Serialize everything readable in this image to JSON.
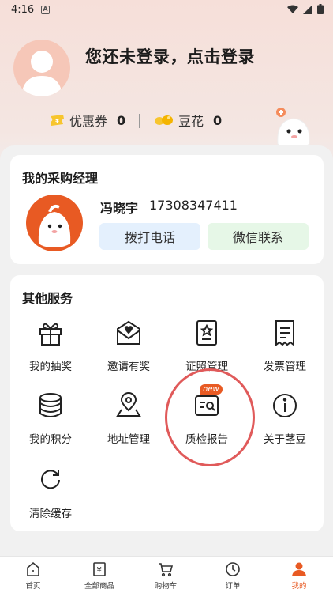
{
  "status_bar": {
    "time": "4:16",
    "notification_icon": "A"
  },
  "header": {
    "login_prompt": "您还未登录，点击登录",
    "coupon_label": "优惠券",
    "coupon_count": "0",
    "douhua_label": "豆花",
    "douhua_count": "0"
  },
  "manager": {
    "title": "我的采购经理",
    "name": "冯晓宇",
    "phone": "17308347411",
    "call_label": "拨打电话",
    "wechat_label": "微信联系"
  },
  "services": {
    "title": "其他服务",
    "new_badge": "new",
    "items": [
      {
        "label": "我的抽奖",
        "icon": "gift-icon"
      },
      {
        "label": "邀请有奖",
        "icon": "invite-envelope-icon"
      },
      {
        "label": "证照管理",
        "icon": "certificate-icon"
      },
      {
        "label": "发票管理",
        "icon": "invoice-icon"
      },
      {
        "label": "我的积分",
        "icon": "points-stack-icon"
      },
      {
        "label": "地址管理",
        "icon": "location-icon"
      },
      {
        "label": "质检报告",
        "icon": "inspection-report-icon"
      },
      {
        "label": "关于茎豆",
        "icon": "info-icon"
      },
      {
        "label": "清除缓存",
        "icon": "refresh-icon"
      }
    ]
  },
  "bottom_nav": [
    {
      "label": "首页",
      "icon": "home-icon"
    },
    {
      "label": "全部商品",
      "icon": "all-products-icon"
    },
    {
      "label": "购物车",
      "icon": "cart-icon"
    },
    {
      "label": "订单",
      "icon": "order-clock-icon"
    },
    {
      "label": "我的",
      "icon": "profile-icon",
      "active": true
    }
  ],
  "colors": {
    "accent": "#e85a23",
    "highlight_circle": "#e05a5a"
  }
}
